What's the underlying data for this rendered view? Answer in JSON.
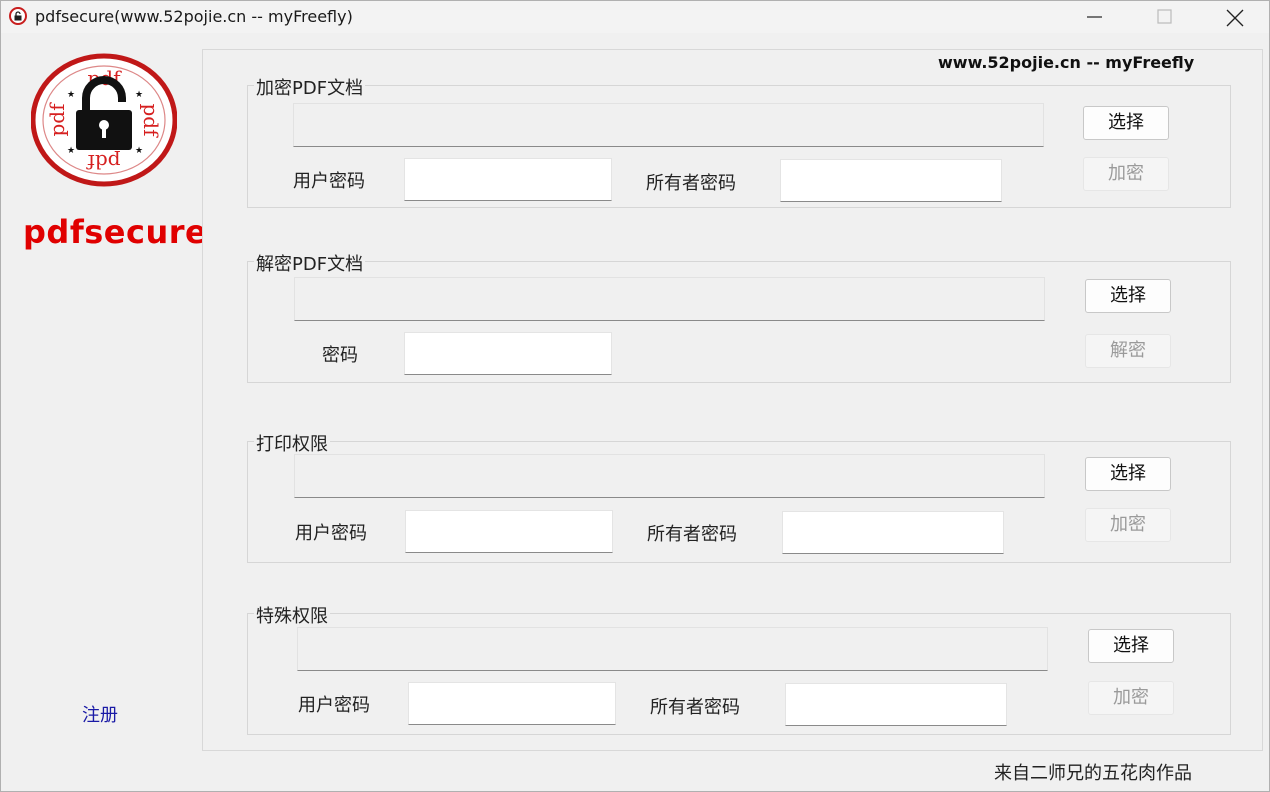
{
  "window": {
    "title": "pdfsecure(www.52pojie.cn -- myFreefly)"
  },
  "brand": {
    "name": "pdfsecure",
    "logo_text": "pdf"
  },
  "website": "www.52pojie.cn -- myFreefly",
  "register_link": "注册",
  "footer_credit": "来自二师兄的五花肉作品",
  "encrypt_section": {
    "title": "加密PDF文档",
    "file_path": "",
    "user_password_label": "用户密码",
    "user_password": "",
    "owner_password_label": "所有者密码",
    "owner_password": "",
    "select_button": "选择",
    "action_button": "加密"
  },
  "decrypt_section": {
    "title": "解密PDF文档",
    "file_path": "",
    "password_label": "密码",
    "password": "",
    "select_button": "选择",
    "action_button": "解密"
  },
  "print_section": {
    "title": "打印权限",
    "file_path": "",
    "user_password_label": "用户密码",
    "user_password": "",
    "owner_password_label": "所有者密码",
    "owner_password": "",
    "select_button": "选择",
    "action_button": "加密"
  },
  "special_section": {
    "title": "特殊权限",
    "file_path": "",
    "user_password_label": "用户密码",
    "user_password": "",
    "owner_password_label": "所有者密码",
    "owner_password": "",
    "select_button": "选择",
    "action_button": "加密"
  },
  "colors": {
    "brand_red": "#e00000",
    "link_blue": "#1a1aa6",
    "disabled_text": "#9a9a9a"
  }
}
